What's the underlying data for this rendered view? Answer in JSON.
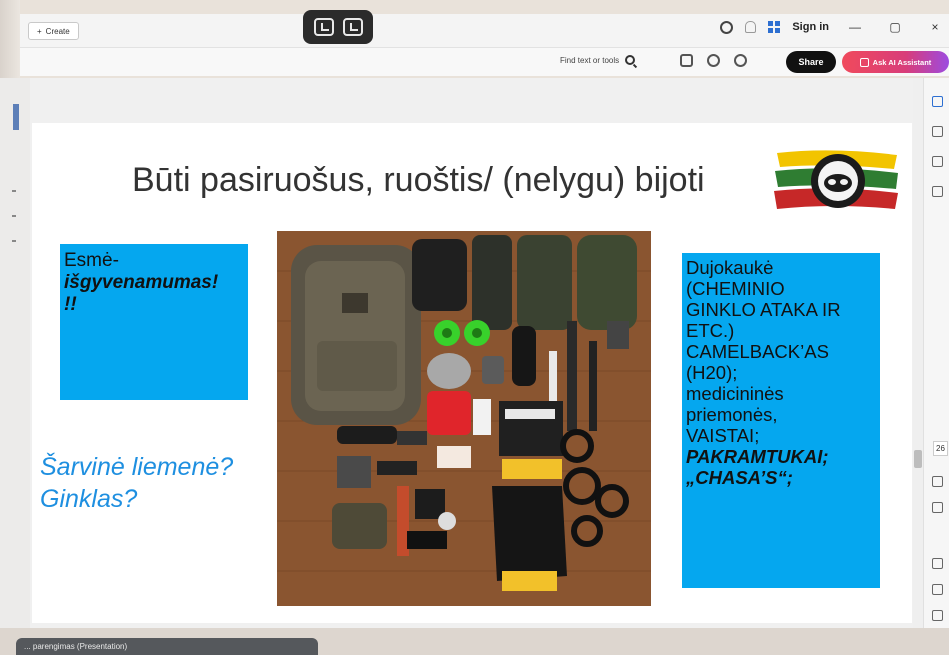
{
  "toolbar": {
    "create_label": "Create",
    "sign_in": "Sign in",
    "find_label": "Find text or tools",
    "share_label": "Share",
    "ai_label": "Ask AI Assistant",
    "minimize": "—",
    "maximize": "▢",
    "close": "×"
  },
  "slide": {
    "title": "Būti pasiruošus, ruoštis/ (nelygu) bijoti",
    "left_box": {
      "line1": "Esmė-",
      "line2": "išgyvenamumas!",
      "line3": "!!"
    },
    "armor_question": {
      "line1": "Šarvinė liemenė?",
      "line2": "Ginklas?"
    },
    "right_box": {
      "line1": "Dujokaukė",
      "line2": "(CHEMINIO",
      "line3": "GINKLO ATAKA IR",
      "line4": "ETC.)",
      "line5": "CAMELBACK’AS",
      "line6": "(H20);",
      "line7": "medicininės",
      "line8": "priemonės,",
      "line9": "VAISTAI;",
      "line10": "PAKRAMTUKAI;",
      "line11": "„CHASA’S“;"
    }
  },
  "right_rail": {
    "page_number": "26"
  },
  "bottom_tab": {
    "label": "... parengimas (Presentation)"
  },
  "colors": {
    "box_blue": "#05a7ef",
    "armor_text": "#1e8fe0",
    "ai_gradient_start": "#f04a5c",
    "ai_gradient_end": "#9d4be0"
  }
}
